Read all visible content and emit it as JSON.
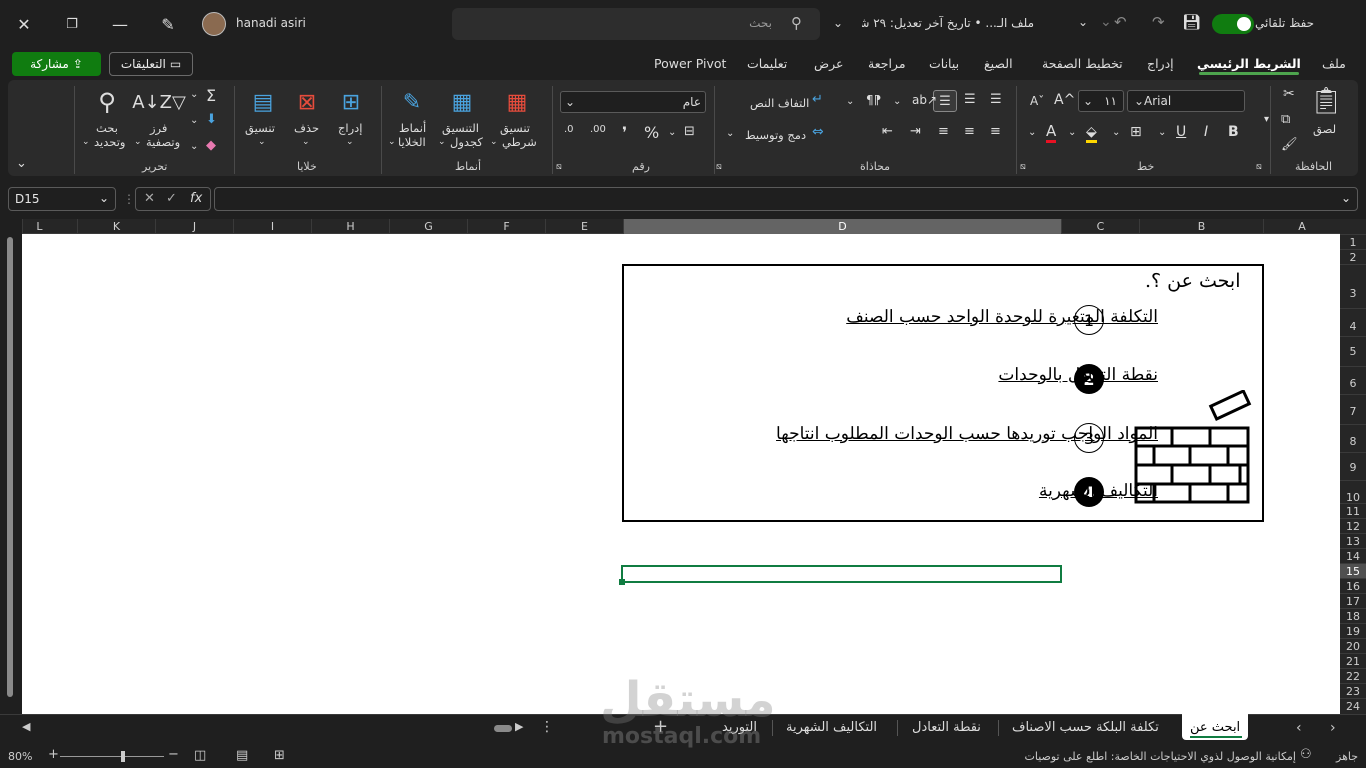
{
  "titlebar": {
    "user_name": "hanadi asiri",
    "search_placeholder": "بحث",
    "doc_title": "ملف الـ... • تاريخ آخر تعديل: ٢٩ شـ...",
    "autosave_label": "حفظ تلقائي"
  },
  "menu": {
    "share": "مشاركة",
    "comments": "التعليقات",
    "tabs": [
      "ملف",
      "الشريط الرئيسي",
      "إدراج",
      "تخطيط الصفحة",
      "الصيغ",
      "بيانات",
      "مراجعة",
      "عرض",
      "تعليمات",
      "Power Pivot"
    ]
  },
  "ribbon": {
    "font_name": "Arial",
    "font_size": "١١",
    "number_format": "عام",
    "paste": "لصق",
    "wrap_text": "التفاف النص",
    "merge_center": "دمج وتوسيط",
    "conditional_1": "تنسيق",
    "conditional_2": "شرطي",
    "as_table_1": "التنسيق",
    "as_table_2": "كجدول",
    "cell_styles_1": "أنماط",
    "cell_styles_2": "الخلايا",
    "insert": "إدراج",
    "delete": "حذف",
    "format": "تنسيق",
    "sort_1": "فرز",
    "sort_2": "وتصفية",
    "find_1": "بحث",
    "find_2": "وتحديد",
    "groups": {
      "clipboard": "الحافظة",
      "font": "خط",
      "alignment": "محاذاة",
      "number": "رقم",
      "styles": "أنماط",
      "cells": "خلايا",
      "editing": "تحرير"
    }
  },
  "formula_bar": {
    "name_box": "D15",
    "fx": "fx",
    "formula": ""
  },
  "columns": [
    "L",
    "K",
    "J",
    "I",
    "H",
    "G",
    "F",
    "E",
    "D",
    "C",
    "B",
    "A"
  ],
  "rows": [
    "1",
    "2",
    "3",
    "4",
    "5",
    "6",
    "7",
    "8",
    "9",
    "10",
    "11",
    "12",
    "13",
    "14",
    "15",
    "16",
    "17",
    "18",
    "19",
    "20",
    "21",
    "22",
    "23",
    "24"
  ],
  "content": {
    "title": "ابحث عن ؟.",
    "items": [
      {
        "num": "1",
        "text": "التكلفة المتغيرة للوحدة الواحد حسب الصنف"
      },
      {
        "num": "2",
        "text": "نقطة التعادل بالوحدات"
      },
      {
        "num": "3",
        "text": "المواد الواجب توريدها حسب الوحدات المطلوب انتاجها"
      },
      {
        "num": "4",
        "text": "التكاليف الشهرية"
      }
    ]
  },
  "sheet_tabs": [
    "ابحث عن",
    "تكلفة البلكة حسب الاصناف",
    "نقطة التعادل",
    "التكاليف الشهرية",
    "التوريد"
  ],
  "status": {
    "ready": "جاهز",
    "accessibility": "إمكانية الوصول لذوي الاحتياجات الخاصة: اطلع على توصيات",
    "zoom": "80%"
  },
  "watermark": {
    "arabic": "مستقل",
    "latin": "mostaql.com"
  }
}
